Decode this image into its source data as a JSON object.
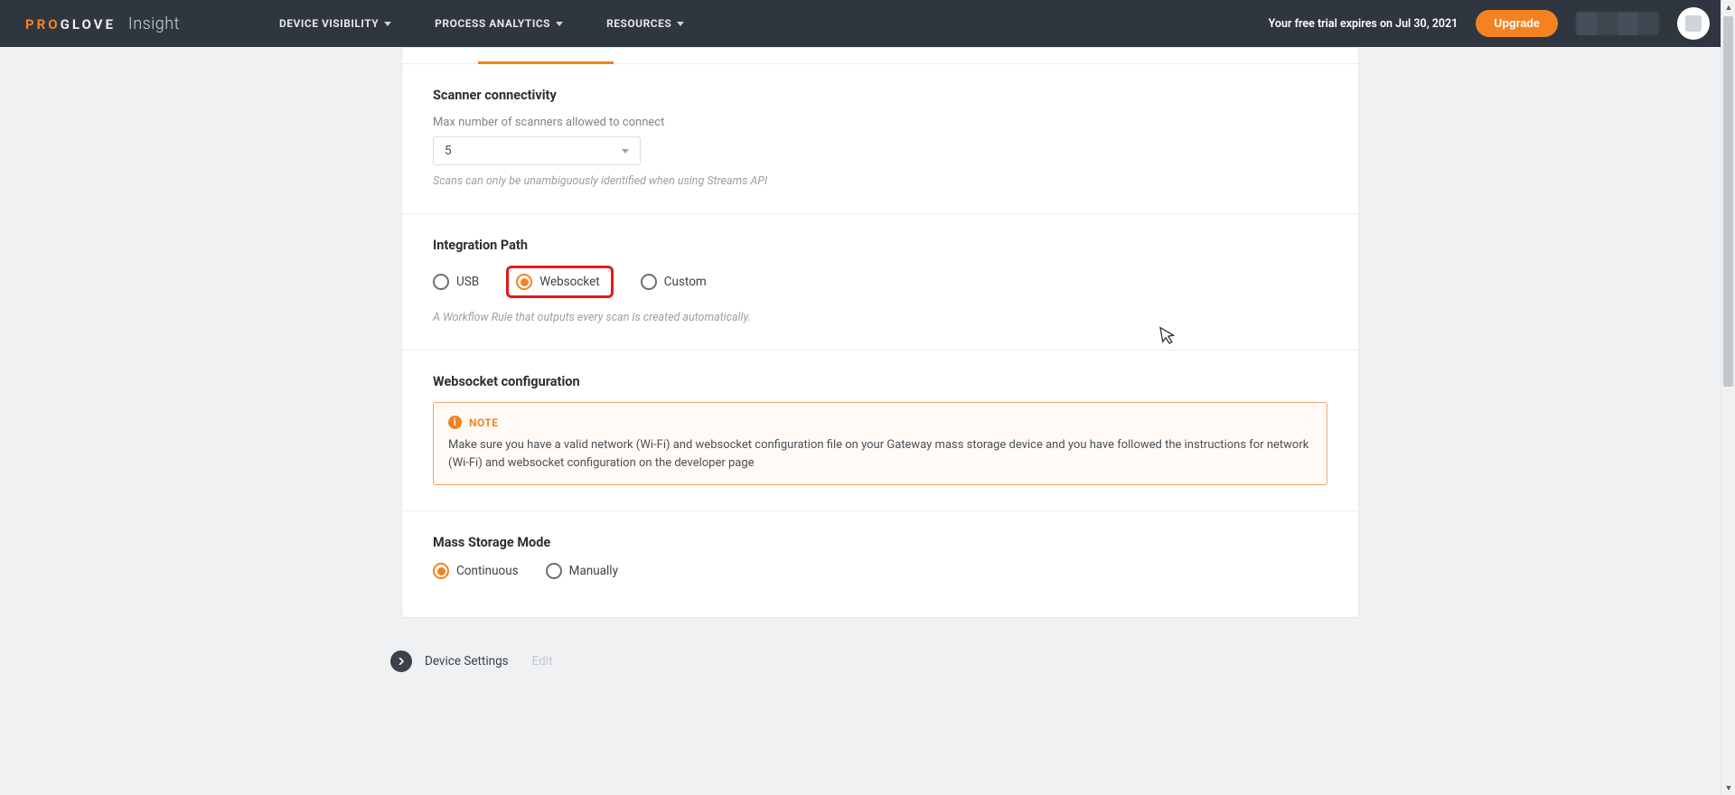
{
  "brand": {
    "pro": "PRO",
    "glove": "GLOVE",
    "product": "Insight"
  },
  "nav": {
    "items": [
      "DEVICE VISIBILITY",
      "PROCESS ANALYTICS",
      "RESOURCES"
    ]
  },
  "trial": {
    "text": "Your free trial expires on Jul 30, 2021"
  },
  "actions": {
    "upgrade": "Upgrade"
  },
  "sections": {
    "scanner": {
      "title": "Scanner connectivity",
      "label": "Max number of scanners allowed to connect",
      "value": "5",
      "hint": "Scans can only be unambiguously identified when using Streams API"
    },
    "integration": {
      "title": "Integration Path",
      "options": {
        "usb": "USB",
        "websocket": "Websocket",
        "custom": "Custom"
      },
      "selected": "websocket",
      "hint": "A Workflow Rule that outputs every scan is created automatically."
    },
    "wsconfig": {
      "title": "Websocket configuration",
      "note_label": "NOTE",
      "note_body": "Make sure you have a valid network (Wi-Fi) and websocket configuration file on your Gateway mass storage device and you have followed the instructions for network (Wi-Fi) and websocket configuration on the developer page"
    },
    "mass": {
      "title": "Mass Storage Mode",
      "options": {
        "continuous": "Continuous",
        "manually": "Manually"
      },
      "selected": "continuous"
    }
  },
  "breadcrumb": {
    "main": "Device Settings",
    "sub": "Edit"
  }
}
